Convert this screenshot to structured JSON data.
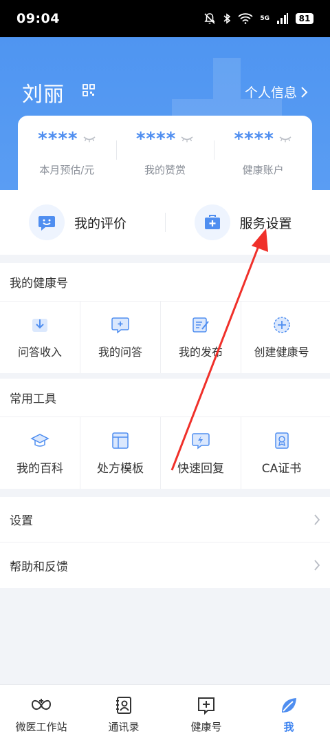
{
  "status_bar": {
    "time": "09:04",
    "battery": "81",
    "network": "5G"
  },
  "header": {
    "user_name": "刘丽",
    "profile_link": "个人信息"
  },
  "stats": [
    {
      "value": "****",
      "label": "本月预估/元"
    },
    {
      "value": "****",
      "label": "我的赞赏"
    },
    {
      "value": "****",
      "label": "健康账户"
    }
  ],
  "quick_actions": [
    {
      "label": "我的评价"
    },
    {
      "label": "服务设置"
    }
  ],
  "health_section": {
    "title": "我的健康号",
    "items": [
      {
        "label": "问答收入"
      },
      {
        "label": "我的问答"
      },
      {
        "label": "我的发布"
      },
      {
        "label": "创建健康号"
      }
    ]
  },
  "tools_section": {
    "title": "常用工具",
    "items": [
      {
        "label": "我的百科"
      },
      {
        "label": "处方模板"
      },
      {
        "label": "快速回复"
      },
      {
        "label": "CA证书"
      }
    ]
  },
  "list": [
    {
      "label": "设置"
    },
    {
      "label": "帮助和反馈"
    }
  ],
  "tabbar": [
    {
      "label": "微医工作站"
    },
    {
      "label": "通讯录"
    },
    {
      "label": "健康号"
    },
    {
      "label": "我"
    }
  ],
  "colors": {
    "accent": "#4f8ef0",
    "header_bg": "#5a9df3",
    "annotation_arrow": "#f0302a"
  }
}
